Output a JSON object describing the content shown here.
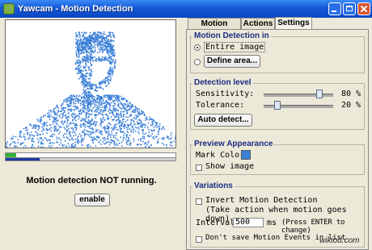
{
  "window": {
    "title": "Yawcam - Motion Detection"
  },
  "preview": {
    "progress_value": 0.06,
    "progress2_value": 0.2
  },
  "left": {
    "status": "Motion detection NOT running.",
    "enable_label": "enable"
  },
  "tabs": [
    {
      "label": "Motion Events",
      "active": false
    },
    {
      "label": "Actions",
      "active": false
    },
    {
      "label": "Settings",
      "active": true
    }
  ],
  "detection_in": {
    "title": "Motion Detection in",
    "entire": "Entire image",
    "define_label": "Define area..."
  },
  "detection_level": {
    "title": "Detection level",
    "sensitivity_label": "Sensitivity:",
    "sensitivity_value": "80 %",
    "sensitivity": 0.8,
    "tolerance_label": "Tolerance:",
    "tolerance_value": "20 %",
    "tolerance": 0.2,
    "auto_detect_label": "Auto detect..."
  },
  "appearance": {
    "title": "Preview Appearance",
    "mark_color_label": "Mark Color:",
    "mark_color": "#3b7fd8",
    "show_image_label": "Show image"
  },
  "variations": {
    "title": "Variations",
    "invert_label": "Invert Motion Detection",
    "invert_note": "(Take action when motion goes down)",
    "interval_label": "Interval:",
    "interval_value": "500",
    "interval_unit": "ms",
    "interval_hint": "(Press ENTER to change)",
    "dont_save_label": "Don't save Motion Events in list"
  },
  "watermark": "wikiod.com",
  "colors": {
    "titlebar": "#1659d6",
    "group_title": "#1b2c84",
    "progress": "#35b33d",
    "mark": "#3b7fd8"
  }
}
